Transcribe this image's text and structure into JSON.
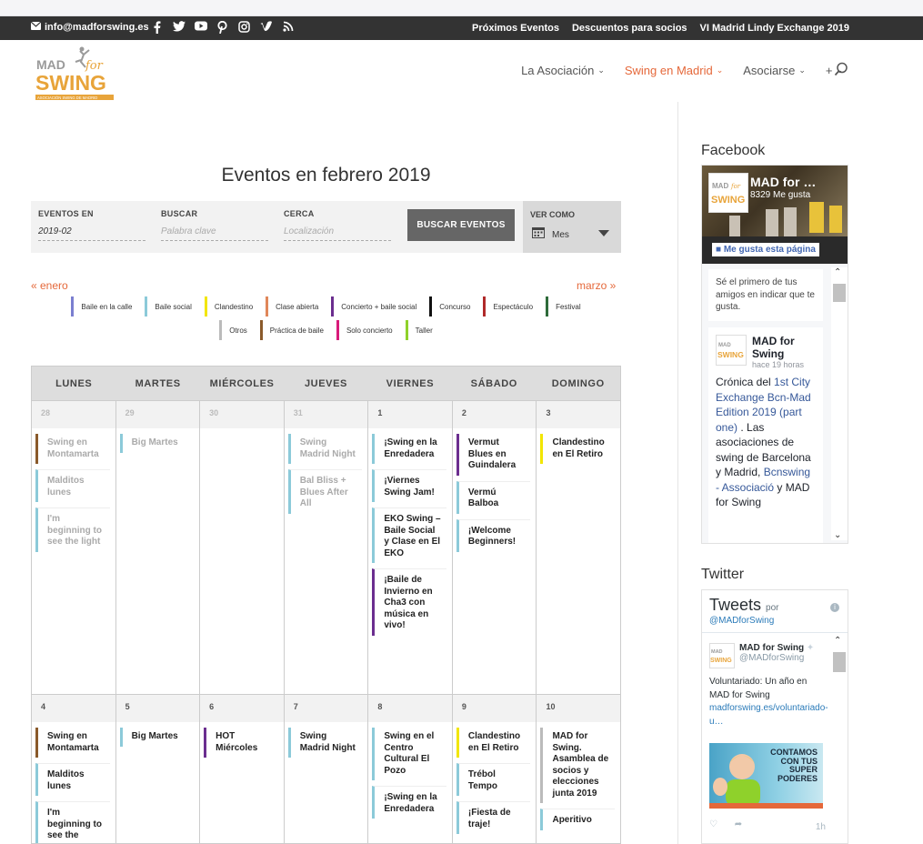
{
  "topbar": {
    "email": "info@madforswing.es",
    "social_icons": [
      "facebook-icon",
      "twitter-icon",
      "youtube-icon",
      "pinterest-icon",
      "instagram-icon",
      "vimeo-icon",
      "rss-icon"
    ],
    "links": [
      "Próximos Eventos",
      "Descuentos para socios",
      "VI Madrid Lindy Exchange 2019"
    ]
  },
  "header": {
    "logo_text": {
      "top": "MAD",
      "for": "for",
      "main": "SWING",
      "tag": "ASOCIACIÓN SWING DE MADRID"
    },
    "nav": [
      {
        "label": "La Asociación",
        "active": false
      },
      {
        "label": "Swing en Madrid",
        "active": true
      },
      {
        "label": "Asociarse",
        "active": false
      },
      {
        "label": "+",
        "active": false
      }
    ]
  },
  "main": {
    "title": "Eventos en febrero 2019",
    "filters": {
      "eventos_label": "EVENTOS EN",
      "eventos_value": "2019-02",
      "buscar_label": "BUSCAR",
      "buscar_placeholder": "Palabra clave",
      "cerca_label": "CERCA",
      "cerca_placeholder": "Localización",
      "button": "BUSCAR EVENTOS",
      "view_label": "VER COMO",
      "view_value": "Mes"
    },
    "prev": "« enero",
    "next": "marzo »",
    "legend_row1": [
      {
        "label": "Baile en la calle",
        "color": "#7b7fd0"
      },
      {
        "label": "Baile social",
        "color": "#8ccad9"
      },
      {
        "label": "Clandestino",
        "color": "#f2e600"
      },
      {
        "label": "Clase abierta",
        "color": "#e0875a"
      },
      {
        "label": "Concierto + baile social",
        "color": "#6b2e8f"
      },
      {
        "label": "Concurso",
        "color": "#111111"
      },
      {
        "label": "Espectáculo",
        "color": "#b02a2a"
      },
      {
        "label": "Festival",
        "color": "#2e6b3a"
      }
    ],
    "legend_row2": [
      {
        "label": "Otros",
        "color": "#bbbbbb"
      },
      {
        "label": "Práctica de baile",
        "color": "#8a5a2b"
      },
      {
        "label": "Solo concierto",
        "color": "#d81b7a"
      },
      {
        "label": "Taller",
        "color": "#8fd12b"
      }
    ],
    "weekdays": [
      "LUNES",
      "MARTES",
      "MIÉRCOLES",
      "JUEVES",
      "VIERNES",
      "SÁBADO",
      "DOMINGO"
    ],
    "week1": [
      {
        "num": "28",
        "other": true,
        "events": [
          {
            "t": "Swing en Montamarta",
            "c": "#8a5a2b"
          },
          {
            "t": "Malditos lunes",
            "c": "#8ccad9"
          },
          {
            "t": "I'm beginning to see the light",
            "c": "#8ccad9"
          }
        ]
      },
      {
        "num": "29",
        "other": true,
        "events": [
          {
            "t": "Big Martes",
            "c": "#8ccad9"
          }
        ]
      },
      {
        "num": "30",
        "other": true,
        "events": []
      },
      {
        "num": "31",
        "other": true,
        "events": [
          {
            "t": "Swing Madrid Night",
            "c": "#8ccad9"
          },
          {
            "t": "Bal Bliss + Blues After All",
            "c": "#8ccad9"
          }
        ]
      },
      {
        "num": "1",
        "other": false,
        "events": [
          {
            "t": "¡Swing en la Enredadera",
            "c": "#8ccad9"
          },
          {
            "t": "¡Viernes Swing Jam!",
            "c": "#8ccad9"
          },
          {
            "t": "EKO Swing – Baile Social y Clase en El EKO",
            "c": "#8ccad9"
          },
          {
            "t": "¡Baile de Invierno en Cha3 con música en vivo!",
            "c": "#6b2e8f"
          }
        ]
      },
      {
        "num": "2",
        "other": false,
        "events": [
          {
            "t": "Vermut Blues en Guindalera",
            "c": "#6b2e8f"
          },
          {
            "t": "Vermú Balboa",
            "c": "#8ccad9"
          },
          {
            "t": "¡Welcome Beginners!",
            "c": "#8ccad9"
          }
        ]
      },
      {
        "num": "3",
        "other": false,
        "events": [
          {
            "t": "Clandestino en El Retiro",
            "c": "#f2e600"
          }
        ]
      }
    ],
    "week2": [
      {
        "num": "4",
        "other": false,
        "events": [
          {
            "t": "Swing en Montamarta",
            "c": "#8a5a2b"
          },
          {
            "t": "Malditos lunes",
            "c": "#8ccad9"
          },
          {
            "t": "I'm beginning to see the",
            "c": "#8ccad9"
          }
        ]
      },
      {
        "num": "5",
        "other": false,
        "events": [
          {
            "t": "Big Martes",
            "c": "#8ccad9"
          }
        ]
      },
      {
        "num": "6",
        "other": false,
        "events": [
          {
            "t": "HOT Miércoles",
            "c": "#6b2e8f"
          }
        ]
      },
      {
        "num": "7",
        "other": false,
        "events": [
          {
            "t": "Swing Madrid Night",
            "c": "#8ccad9"
          }
        ]
      },
      {
        "num": "8",
        "other": false,
        "events": [
          {
            "t": "Swing en el Centro Cultural El Pozo",
            "c": "#8ccad9"
          },
          {
            "t": "¡Swing en la Enredadera",
            "c": "#8ccad9"
          }
        ]
      },
      {
        "num": "9",
        "other": false,
        "events": [
          {
            "t": "Clandestino en El Retiro",
            "c": "#f2e600"
          },
          {
            "t": "Trébol Tempo",
            "c": "#8ccad9"
          },
          {
            "t": "¡Fiesta de traje!",
            "c": "#8ccad9"
          }
        ]
      },
      {
        "num": "10",
        "other": false,
        "events": [
          {
            "t": "MAD for Swing. Asamblea de socios y elecciones junta 2019",
            "c": "#bbbbbb"
          },
          {
            "t": "Aperitivo",
            "c": "#8ccad9"
          }
        ]
      }
    ]
  },
  "sidebar": {
    "facebook": {
      "title": "Facebook",
      "page_name": "MAD for …",
      "likes": "8329 Me gusta",
      "like_button": "Me gusta esta página",
      "first_text": "Sé el primero de tus amigos en indicar que te gusta.",
      "post_name": "MAD for Swing",
      "post_time": "hace 19 horas",
      "post_text_a": "Crónica del ",
      "post_link1": "1st City Exchange Bcn-Mad Edition 2019 (part one)",
      "post_text_b": " . Las asociaciones de swing de Barcelona y Madrid, ",
      "post_link2": "Bcnswing - Associació",
      "post_text_c": " y MAD for Swing"
    },
    "twitter": {
      "title": "Twitter",
      "head": "Tweets",
      "por": "por",
      "handle": "@MADforSwing",
      "tweet_name": "MAD for Swing",
      "tweet_handle": "@MADforSwing",
      "tweet_text": "Voluntariado: Un año en MAD for Swing",
      "tweet_link": "madforswing.es/voluntariado-u…",
      "img_text": "CONTAMOS CON TUS SUPER PODERES",
      "time": "1h"
    }
  }
}
